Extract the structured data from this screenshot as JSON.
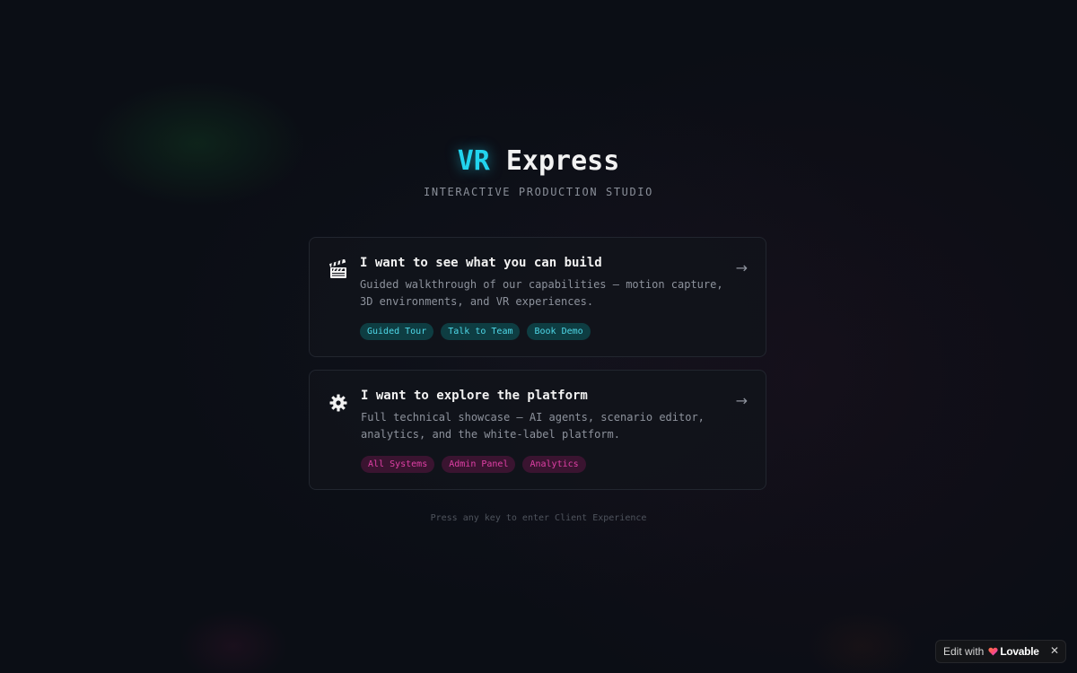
{
  "header": {
    "title_accent": "VR",
    "title_rest": " Express",
    "subtitle": "INTERACTIVE PRODUCTION STUDIO"
  },
  "cards": [
    {
      "icon": "clapper-board-icon",
      "title": "I want to see what you can build",
      "description": "Guided walkthrough of our capabilities — motion capture, 3D environments, and VR experiences.",
      "tags": [
        "Guided Tour",
        "Talk to Team",
        "Book Demo"
      ],
      "arrow": "→"
    },
    {
      "icon": "gear-icon",
      "title": "I want to explore the platform",
      "description": "Full technical showcase — AI agents, scenario editor, analytics, and the white-label platform.",
      "tags": [
        "All Systems",
        "Admin Panel",
        "Analytics"
      ],
      "arrow": "→"
    }
  ],
  "hint": "Press any key to enter Client Experience",
  "lovable_badge": {
    "edit_label": "Edit with",
    "brand": "Lovable",
    "close": "✕"
  },
  "colors": {
    "accent_cyan": "#22d3ee",
    "tag_cyan_bg": "#0e3d42",
    "tag_pink_bg": "#3a1430",
    "tag_pink_text": "#e040a6",
    "background": "#0b0e15"
  }
}
